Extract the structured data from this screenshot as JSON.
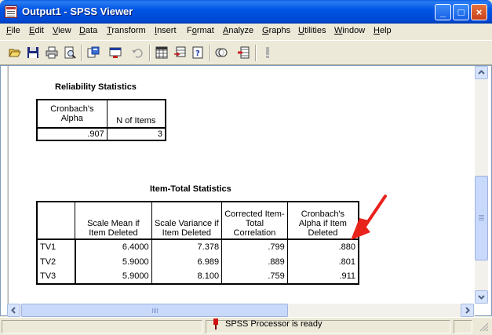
{
  "window": {
    "title": "Output1 - SPSS Viewer",
    "minimize_glyph": "_",
    "maximize_glyph": "□",
    "close_glyph": "×"
  },
  "menu": [
    {
      "label": "File",
      "accel": "F"
    },
    {
      "label": "Edit",
      "accel": "E"
    },
    {
      "label": "View",
      "accel": "V"
    },
    {
      "label": "Data",
      "accel": "D"
    },
    {
      "label": "Transform",
      "accel": "T"
    },
    {
      "label": "Insert",
      "accel": "I"
    },
    {
      "label": "Format",
      "accel": "o"
    },
    {
      "label": "Analyze",
      "accel": "A"
    },
    {
      "label": "Graphs",
      "accel": "G"
    },
    {
      "label": "Utilities",
      "accel": "U"
    },
    {
      "label": "Window",
      "accel": "W"
    },
    {
      "label": "Help",
      "accel": "H"
    }
  ],
  "toolbar_icons": [
    "open-icon",
    "save-icon",
    "print-icon",
    "print-preview-icon",
    "export-icon",
    "recall-dialog-icon",
    "undo-icon",
    "goto-data-icon",
    "goto-case-icon",
    "variables-icon",
    "use-sets-icon",
    "designate-window-icon",
    "run-icon"
  ],
  "reliability": {
    "title": "Reliability Statistics",
    "headers": [
      "Cronbach's Alpha",
      "N of Items"
    ],
    "row": [
      ".907",
      "3"
    ]
  },
  "item_total": {
    "title": "Item-Total Statistics",
    "headers": [
      "",
      "Scale Mean if Item Deleted",
      "Scale Variance if Item Deleted",
      "Corrected Item-Total Correlation",
      "Cronbach's Alpha if Item Deleted"
    ],
    "rows": [
      [
        "TV1",
        "6.4000",
        "7.378",
        ".799",
        ".880"
      ],
      [
        "TV2",
        "5.9000",
        "6.989",
        ".889",
        ".801"
      ],
      [
        "TV3",
        "5.9000",
        "8.100",
        ".759",
        ".911"
      ]
    ]
  },
  "status": {
    "text": "SPSS Processor  is ready"
  },
  "colors": {
    "titlebar": "#0055e5",
    "annotation_arrow": "#e8231c",
    "status_icon": "#d01010"
  }
}
